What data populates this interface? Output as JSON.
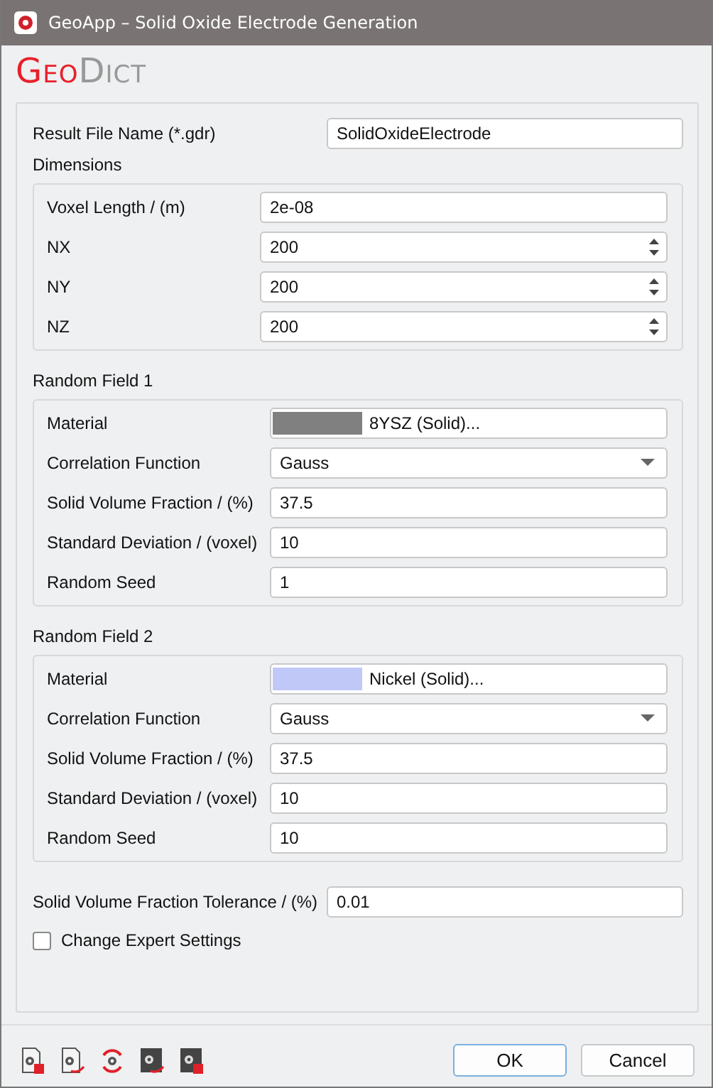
{
  "window": {
    "title": "GeoApp – Solid Oxide Electrode Generation"
  },
  "logo": {
    "part1": "Geo",
    "part2": "Dict"
  },
  "result_file": {
    "label": "Result File Name (*.gdr)",
    "value": "SolidOxideElectrode"
  },
  "dimensions": {
    "title": "Dimensions",
    "fields": [
      {
        "kind": "text",
        "label": "Voxel Length / (m)",
        "value": "2e-08"
      },
      {
        "kind": "spin",
        "label": "NX",
        "value": "200"
      },
      {
        "kind": "spin",
        "label": "NY",
        "value": "200"
      },
      {
        "kind": "spin",
        "label": "NZ",
        "value": "200"
      }
    ]
  },
  "random_fields": [
    {
      "title": "Random Field 1",
      "rows": [
        {
          "kind": "material",
          "label": "Material",
          "value": "8YSZ (Solid)...",
          "color": "#808080"
        },
        {
          "kind": "dropdown",
          "label": "Correlation Function",
          "value": "Gauss"
        },
        {
          "kind": "text",
          "label": "Solid Volume Fraction / (%)",
          "value": "37.5"
        },
        {
          "kind": "text",
          "label": "Standard Deviation / (voxel)",
          "value": "10"
        },
        {
          "kind": "text",
          "label": "Random Seed",
          "value": "1"
        }
      ]
    },
    {
      "title": "Random Field 2",
      "rows": [
        {
          "kind": "material",
          "label": "Material",
          "value": "Nickel (Solid)...",
          "color": "#c0c8f8"
        },
        {
          "kind": "dropdown",
          "label": "Correlation Function",
          "value": "Gauss"
        },
        {
          "kind": "text",
          "label": "Solid Volume Fraction / (%)",
          "value": "37.5"
        },
        {
          "kind": "text",
          "label": "Standard Deviation / (voxel)",
          "value": "10"
        },
        {
          "kind": "text",
          "label": "Random Seed",
          "value": "10"
        }
      ]
    }
  ],
  "tolerance": {
    "label": "Solid Volume Fraction Tolerance / (%)",
    "value": "0.01"
  },
  "expert_settings": {
    "label": "Change Expert Settings",
    "checked": false
  },
  "buttons": [
    {
      "label": "OK",
      "selected": true
    },
    {
      "label": "Cancel",
      "selected": false
    }
  ]
}
